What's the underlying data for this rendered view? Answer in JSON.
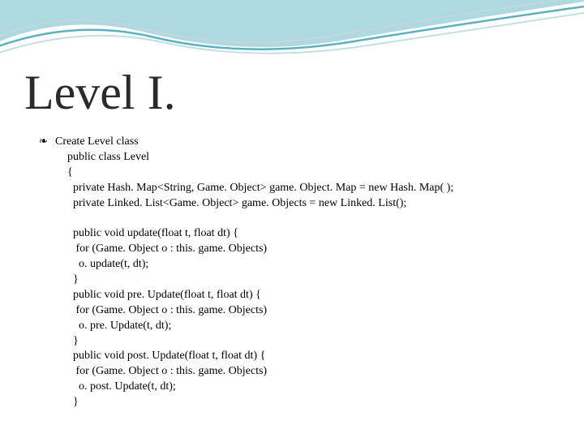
{
  "slide": {
    "title": "Level I.",
    "bullet_glyph": "❧",
    "bullet_text": "Create Level class",
    "code": "  public class Level\n  {\n    private Hash. Map<String, Game. Object> game. Object. Map = new Hash. Map( );\n    private Linked. List<Game. Object> game. Objects = new Linked. List();\n\n    public void update(float t, float dt) {\n     for (Game. Object o : this. game. Objects)\n      o. update(t, dt);\n    }\n    public void pre. Update(float t, float dt) {\n     for (Game. Object o : this. game. Objects)\n      o. pre. Update(t, dt);\n    }\n    public void post. Update(float t, float dt) {\n     for (Game. Object o : this. game. Objects)\n      o. post. Update(t, dt);\n    }"
  }
}
